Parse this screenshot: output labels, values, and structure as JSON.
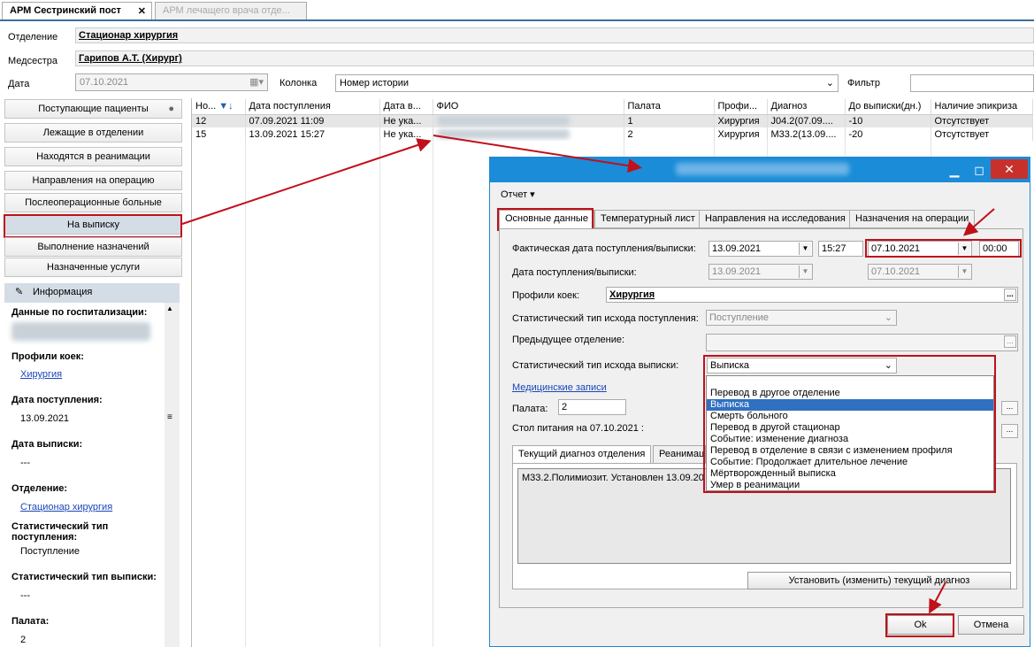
{
  "tabs": [
    {
      "label": "АРМ Сестринский пост",
      "close": "✕"
    },
    {
      "label": "АРМ лечащего врача отде..."
    }
  ],
  "header": {
    "department_label": "Отделение",
    "department_value": "Стационар  хирургия",
    "nurse_label": "Медсестра",
    "nurse_value": "Гарипов А.Т. (Хирург)",
    "date_label": "Дата",
    "date_value": "07.10.2021",
    "column_label": "Колонка",
    "column_value": "Номер истории",
    "filter_label": "Фильтр",
    "filter_value": ""
  },
  "nav": [
    {
      "label": "Поступающие пациенты"
    },
    {
      "label": "Лежащие в отделении"
    },
    {
      "label": "Находятся в реанимации"
    },
    {
      "label": "Направления на операцию"
    },
    {
      "label": "Послеоперационные больные"
    },
    {
      "label": "На выписку"
    },
    {
      "label": "Выполнение назначений"
    },
    {
      "label": "Назначенные услуги"
    }
  ],
  "info": {
    "title": "Информация",
    "hosp_label": "Данные по госпитализации:",
    "profiles_label": "Профили коек:",
    "profiles_value": "Хирургия",
    "admission_label": "Дата поступления:",
    "admission_value": "13.09.2021",
    "discharge_label": "Дата выписки:",
    "discharge_value": "---",
    "dept_label": "Отделение:",
    "dept_value": "Стационар  хирургия",
    "stat_in_label": "Статистический тип поступления:",
    "stat_in_value": "Поступление",
    "stat_out_label": "Статистический тип выписки:",
    "stat_out_value": "---",
    "ward_label": "Палата:",
    "ward_value": "2"
  },
  "grid": {
    "columns": [
      "Но...",
      "Дата поступления",
      "Дата в...",
      "ФИО",
      "Палата",
      "Профи...",
      "Диагноз",
      "До выписки(дн.)",
      "Наличие эпикриза"
    ],
    "rows": [
      [
        "12",
        "07.09.2021 11:09",
        "Не ука...",
        "",
        "1",
        "Хирургия",
        "J04.2(07.09....",
        "-10",
        "Отсутствует"
      ],
      [
        "15",
        "13.09.2021 15:27",
        "Не ука...",
        "",
        "2",
        "Хирургия",
        "M33.2(13.09....",
        "-20",
        "Отсутствует"
      ]
    ]
  },
  "dialog": {
    "menu": "Отчет ▾",
    "tabs": [
      "Основные данные",
      "Температурный лист",
      "Направления на исследования",
      "Назначения на операции"
    ],
    "fact_label": "Фактическая дата поступления/выписки:",
    "fact_in_date": "13.09.2021",
    "fact_in_time": "15:27",
    "fact_out_date": "07.10.2021",
    "fact_out_time": "00:00",
    "date_label": "Дата поступления/выписки:",
    "date_in": "13.09.2021",
    "date_out": "07.10.2021",
    "profiles_label": "Профили коек:",
    "profiles_value": "Хирургия",
    "stat_in_label": "Статистический тип исхода поступления:",
    "stat_in_value": "Поступление",
    "prev_label": "Предыдущее отделение:",
    "stat_out_label": "Статистический тип исхода выписки:",
    "stat_out_value": "Выписка",
    "records_link": "Медицинские записи",
    "ward_label": "Палата:",
    "ward_value": "2",
    "meal_label": "Стол питания на 07.10.2021 :",
    "diag_tabs": [
      "Текущий диагноз отделения",
      "Реанимац"
    ],
    "diag_text": "M33.2.Полимиозит. Установлен 13.09.20",
    "set_diag_button": "Установить (изменить) текущий диагноз",
    "ok": "Ok",
    "cancel": "Отмена",
    "dropdown": [
      "Перевод в другое отделение",
      "Выписка",
      "Смерть больного",
      "Перевод в другой стационар",
      "Событие: изменение диагноза",
      "Перевод в отделение в связи с изменением профиля",
      "Событие: Продолжает длительное лечение",
      "Мёртворожденный выписка",
      "Умер в реанимации"
    ]
  },
  "colors": {
    "titlebar": "#1b8cd8",
    "highlight": "#c0101a",
    "selection": "#3070c0"
  }
}
